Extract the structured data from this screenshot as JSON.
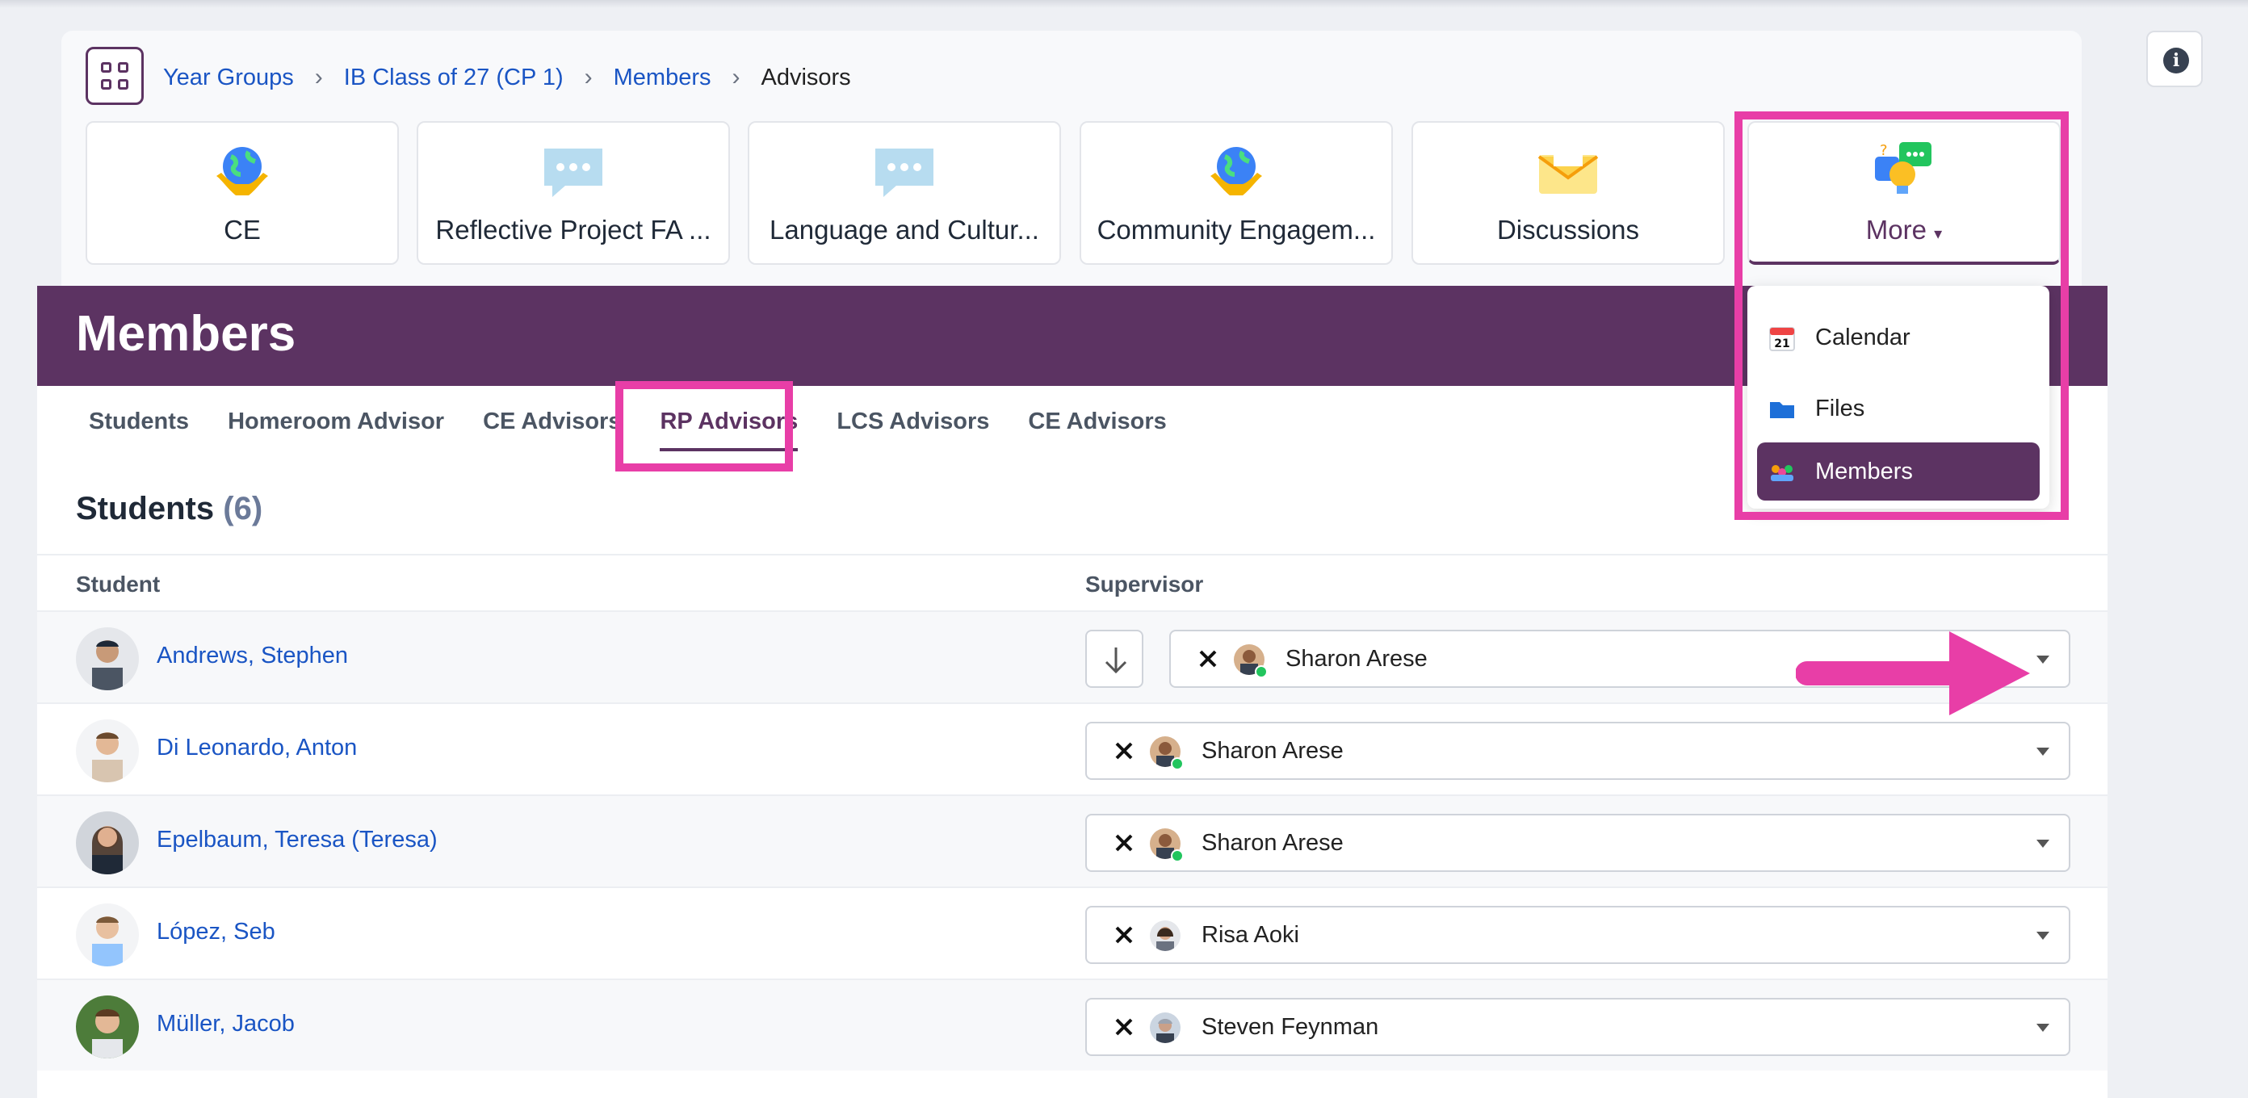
{
  "breadcrumb": {
    "items": [
      "Year Groups",
      "IB Class of 27 (CP 1)",
      "Members"
    ],
    "current": "Advisors"
  },
  "tiles": [
    {
      "label": "CE",
      "icon": "globe-hands-icon"
    },
    {
      "label": "Reflective Project FA ...",
      "icon": "speech-bubble-icon"
    },
    {
      "label": "Language and Cultur...",
      "icon": "speech-bubble-icon"
    },
    {
      "label": "Community Engagem...",
      "icon": "globe-hands-icon"
    },
    {
      "label": "Discussions",
      "icon": "envelope-icon"
    },
    {
      "label": "More",
      "icon": "lightbulb-chat-icon"
    }
  ],
  "page": {
    "title": "Members"
  },
  "tabs": [
    "Students",
    "Homeroom Advisor",
    "CE Advisors",
    "RP Advisors",
    "LCS Advisors",
    "CE Advisors"
  ],
  "active_tab": "RP Advisors",
  "section": {
    "title": "Students",
    "count": "(6)"
  },
  "table": {
    "headers": {
      "student": "Student",
      "supervisor": "Supervisor"
    },
    "rows": [
      {
        "student": "Andrews, Stephen",
        "supervisor": "Sharon Arese",
        "online": true
      },
      {
        "student": "Di Leonardo, Anton",
        "supervisor": "Sharon Arese",
        "online": true
      },
      {
        "student": "Epelbaum, Teresa (Teresa)",
        "supervisor": "Sharon Arese",
        "online": true
      },
      {
        "student": "López, Seb",
        "supervisor": "Risa Aoki",
        "online": false
      },
      {
        "student": "Müller, Jacob",
        "supervisor": "Steven Feynman",
        "online": false
      }
    ]
  },
  "dropdown": {
    "items": [
      {
        "label": "Calendar",
        "icon": "calendar-icon"
      },
      {
        "label": "Files",
        "icon": "folder-icon"
      },
      {
        "label": "Members",
        "icon": "members-icon",
        "active": true
      }
    ]
  },
  "info": {
    "glyph": "i"
  },
  "colors": {
    "brand": "#5c3362",
    "highlight": "#e83ea7",
    "link": "#1a55c4",
    "online": "#22c55e"
  }
}
